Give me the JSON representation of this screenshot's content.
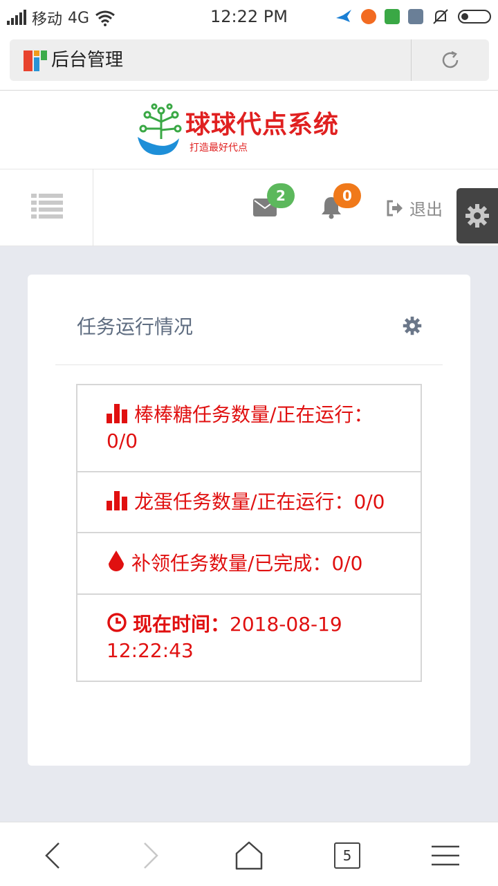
{
  "status_bar": {
    "carrier": "移动",
    "network": "4G",
    "time": "12:22  PM"
  },
  "address_bar": {
    "title": "后台管理"
  },
  "brand": {
    "name": "球球代点系统",
    "slogan": "打造最好代点"
  },
  "nav": {
    "messages_count": "2",
    "notifications_count": "0",
    "logout_label": "退出"
  },
  "panel": {
    "title": "任务运行情况",
    "stats": [
      {
        "icon": "bar-chart-icon",
        "label": "棒棒糖任务数量/正在运行：",
        "value": "0/0"
      },
      {
        "icon": "bar-chart-icon",
        "label": "龙蛋任务数量/正在运行：",
        "value": "0/0"
      },
      {
        "icon": "drop-icon",
        "label": "补领任务数量/已完成：",
        "value": "0/0"
      }
    ],
    "time_label": "现在时间：",
    "time_value": "2018-08-19 12:22:43"
  },
  "bottom_bar": {
    "tabs_count": "5"
  },
  "colors": {
    "accent_red": "#e01010",
    "badge_green": "#5cb85c",
    "badge_orange": "#f0791a",
    "panel_bg": "#e7e9ef"
  }
}
